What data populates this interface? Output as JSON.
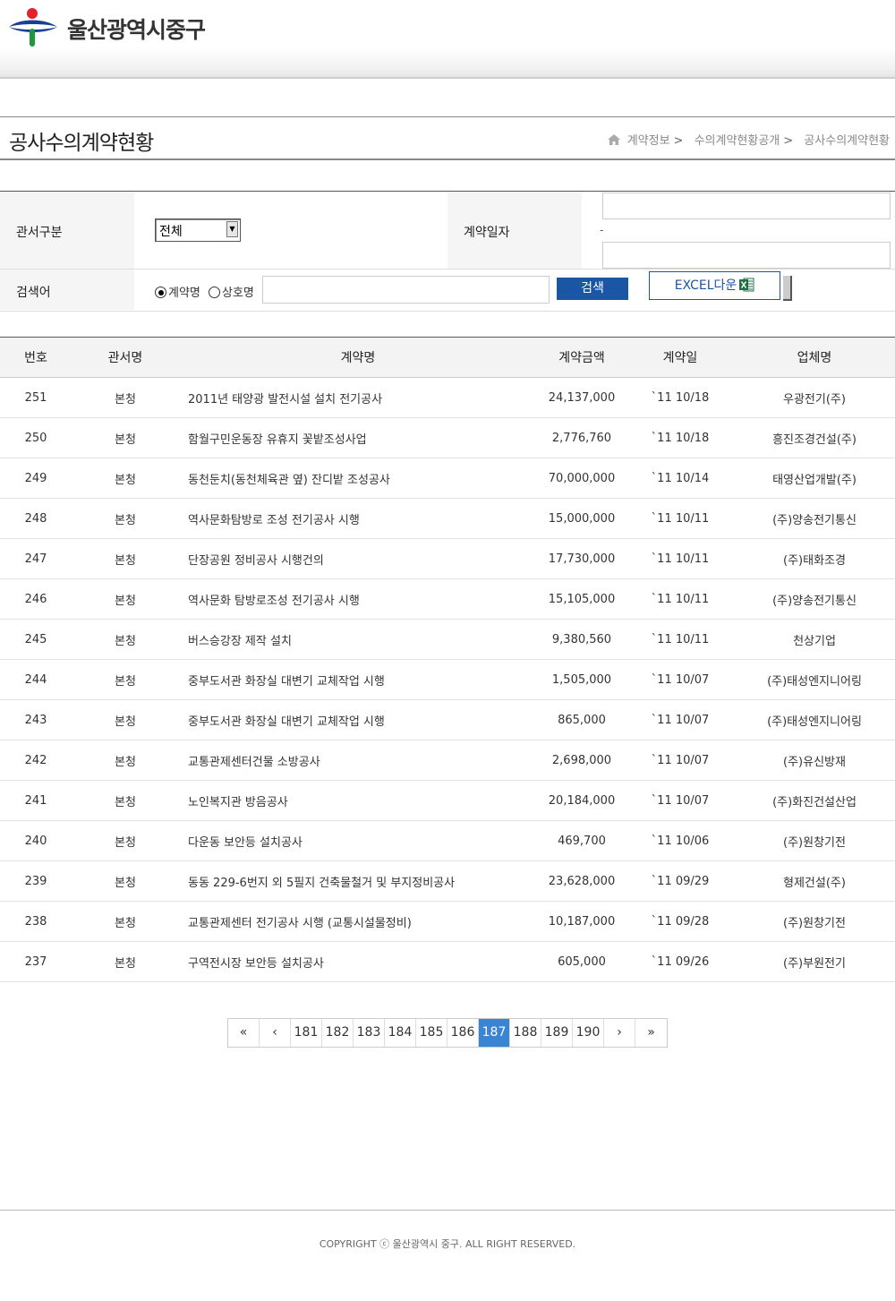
{
  "header": {
    "site_name": "울산광역시중구"
  },
  "page": {
    "title": "공사수의계약현황",
    "breadcrumb": [
      {
        "label": "계약정보",
        "sep": ">"
      },
      {
        "label": "수의계약현황공개",
        "sep": ">"
      },
      {
        "label": "공사수의계약현황",
        "sep": ""
      }
    ]
  },
  "search": {
    "office_label": "관서구분",
    "office_selected": "전체",
    "date_label": "계약일자",
    "date_sep": "-",
    "keyword_label": "검색어",
    "radio_contract": "계약명",
    "radio_company": "상호명",
    "radio_selected": "계약명",
    "search_button": "검색",
    "excel_button": "EXCEL다운"
  },
  "table": {
    "headers": [
      "번호",
      "관서명",
      "계약명",
      "계약금액",
      "계약일",
      "업체명"
    ],
    "rows": [
      [
        "251",
        "본청",
        "2011년 태양광 발전시설 설치 전기공사",
        "24,137,000",
        "`11 10/18",
        "우광전기(주)"
      ],
      [
        "250",
        "본청",
        "함월구민운동장 유휴지 꽃밭조성사업",
        "2,776,760",
        "`11 10/18",
        "흥진조경건설(주)"
      ],
      [
        "249",
        "본청",
        "동천둔치(동천체육관 옆) 잔디밭 조성공사",
        "70,000,000",
        "`11 10/14",
        "태영산업개발(주)"
      ],
      [
        "248",
        "본청",
        "역사문화탐방로 조성 전기공사 시행",
        "15,000,000",
        "`11 10/11",
        "(주)양송전기통신"
      ],
      [
        "247",
        "본청",
        "단장공원 정비공사 시행건의",
        "17,730,000",
        "`11 10/11",
        "(주)태화조경"
      ],
      [
        "246",
        "본청",
        "역사문화 탐방로조성 전기공사 시행",
        "15,105,000",
        "`11 10/11",
        "(주)양송전기통신"
      ],
      [
        "245",
        "본청",
        "버스승강장 제작 설치",
        "9,380,560",
        "`11 10/11",
        "천상기업"
      ],
      [
        "244",
        "본청",
        "중부도서관 화장실 대변기 교체작업 시행",
        "1,505,000",
        "`11 10/07",
        "(주)태성엔지니어링"
      ],
      [
        "243",
        "본청",
        "중부도서관 화장실 대변기 교체작업 시행",
        "865,000",
        "`11 10/07",
        "(주)태성엔지니어링"
      ],
      [
        "242",
        "본청",
        "교통관제센터건물 소방공사",
        "2,698,000",
        "`11 10/07",
        "(주)유신방재"
      ],
      [
        "241",
        "본청",
        "노인복지관 방음공사",
        "20,184,000",
        "`11 10/07",
        "(주)화진건설산업"
      ],
      [
        "240",
        "본청",
        "다운동 보안등 설치공사",
        "469,700",
        "`11 10/06",
        "(주)원창기전"
      ],
      [
        "239",
        "본청",
        "동동 229-6번지 외 5필지 건축물철거 및 부지정비공사",
        "23,628,000",
        "`11 09/29",
        "형제건설(주)"
      ],
      [
        "238",
        "본청",
        "교통관제센터 전기공사 시행 (교통시설물정비)",
        "10,187,000",
        "`11 09/28",
        "(주)원창기전"
      ],
      [
        "237",
        "본청",
        "구역전시장 보안등 설치공사",
        "605,000",
        "`11 09/26",
        "(주)부원전기"
      ]
    ]
  },
  "pagination": {
    "first": "«",
    "prev": "‹",
    "pages": [
      "181",
      "182",
      "183",
      "184",
      "185",
      "186",
      "187",
      "188",
      "189",
      "190"
    ],
    "current": "187",
    "next": "›",
    "last": "»"
  },
  "footer": {
    "copyright": "COPYRIGHT ⓒ 울산광역시 중구. ALL RIGHT RESERVED."
  },
  "colors": {
    "accent": "#1b56a5",
    "active_page": "#3a84d4",
    "logo_red": "#e4202d",
    "logo_blue": "#1b3f94",
    "logo_green": "#1a9a3c"
  }
}
